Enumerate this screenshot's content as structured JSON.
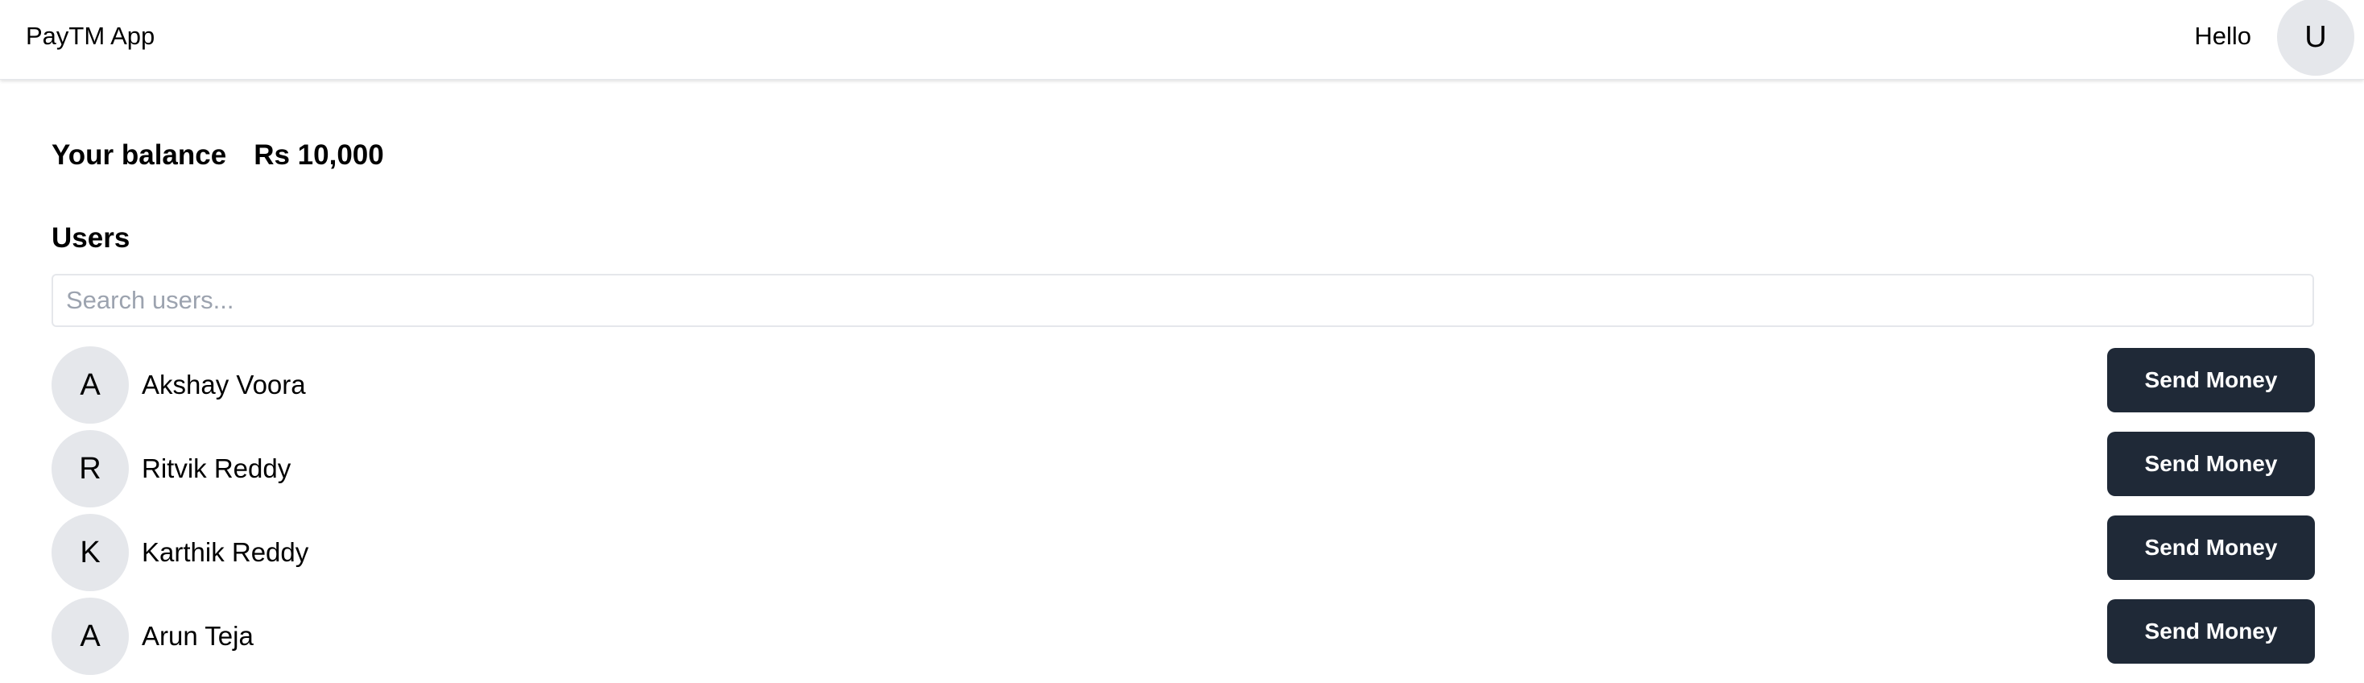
{
  "appbar": {
    "title": "PayTM App",
    "greeting": "Hello",
    "avatar_initial": "U"
  },
  "balance": {
    "label": "Your balance",
    "amount": "Rs 10,000"
  },
  "users_section": {
    "heading": "Users",
    "search_placeholder": "Search users...",
    "search_value": ""
  },
  "users": [
    {
      "initial": "A",
      "name": "Akshay Voora",
      "action": "Send Money"
    },
    {
      "initial": "R",
      "name": "Ritvik Reddy",
      "action": "Send Money"
    },
    {
      "initial": "K",
      "name": "Karthik Reddy",
      "action": "Send Money"
    },
    {
      "initial": "A",
      "name": "Arun Teja",
      "action": "Send Money"
    }
  ],
  "colors": {
    "button_bg": "#1f2937",
    "avatar_bg": "#e5e7eb",
    "border": "#e5e7eb"
  }
}
